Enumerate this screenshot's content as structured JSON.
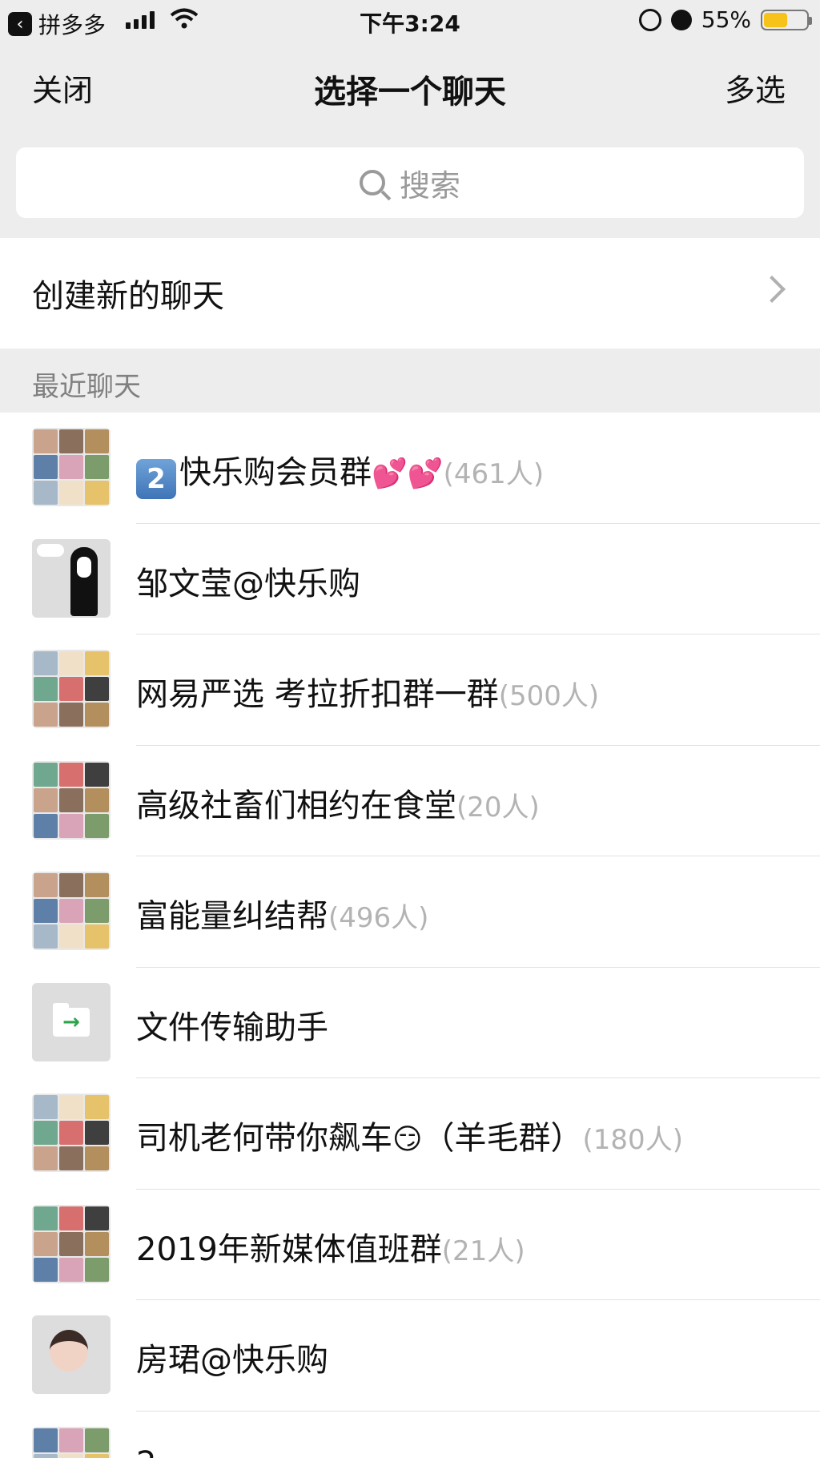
{
  "status_bar": {
    "back_app": "拼多多",
    "time": "下午3:24",
    "battery": "55%",
    "battery_level": 0.55,
    "battery_color": "#f7c31a"
  },
  "nav": {
    "close": "关闭",
    "title": "选择一个聊天",
    "multi_select": "多选"
  },
  "search": {
    "placeholder": "搜索"
  },
  "create_chat": {
    "label": "创建新的聊天"
  },
  "section": {
    "recent": "最近聊天"
  },
  "chats": [
    {
      "badge": "2",
      "name": "快乐购会员群",
      "emoji": "💕💕",
      "count": "(461人)",
      "avatar": "grid"
    },
    {
      "name": "邹文莹@快乐购",
      "count": "",
      "avatar": "yellow"
    },
    {
      "name": "网易严选 考拉折扣群一群",
      "count": "(500人)",
      "avatar": "grid"
    },
    {
      "name": "高级社畜们相约在食堂",
      "count": "(20人)",
      "avatar": "grid"
    },
    {
      "name": "富能量纠结帮",
      "count": "(496人)",
      "avatar": "grid"
    },
    {
      "name": "文件传输助手",
      "count": "",
      "avatar": "file"
    },
    {
      "name": "司机老何带你飙车",
      "emoji": "😏",
      "suffix": "（羊毛群）",
      "count": "(180人)",
      "avatar": "grid"
    },
    {
      "name": "2019年新媒体值班群",
      "count": "(21人)",
      "avatar": "grid"
    },
    {
      "name": "房珺@快乐购",
      "count": "",
      "avatar": "baby"
    },
    {
      "name": "2",
      "count": "",
      "avatar": "grid"
    }
  ],
  "colors": {
    "accent_green": "#2ba44a",
    "background": "#ededed",
    "count_gray": "#b3b3b3"
  }
}
